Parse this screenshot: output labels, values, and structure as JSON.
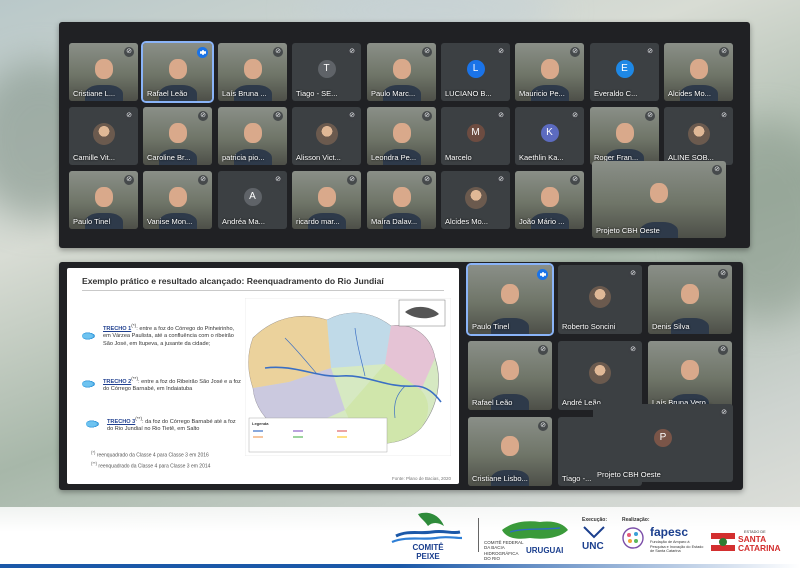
{
  "top_grid": [
    {
      "name": "Cristiane L...",
      "kind": "cam"
    },
    {
      "name": "Rafael Leão",
      "kind": "cam",
      "speaking": true
    },
    {
      "name": "Laís Bruna ...",
      "kind": "cam"
    },
    {
      "name": "Tiago - SE...",
      "kind": "avatar",
      "initial": "T",
      "color": "#5f6368"
    },
    {
      "name": "Paulo Marc...",
      "kind": "cam"
    },
    {
      "name": "LUCIANO B...",
      "kind": "avatar",
      "initial": "L",
      "color": "#1a73e8"
    },
    {
      "name": "Mauricio Pe...",
      "kind": "cam"
    },
    {
      "name": "Everaldo C...",
      "kind": "avatar",
      "initial": "E",
      "color": "#1e88e5"
    },
    {
      "name": "Alcides Mo...",
      "kind": "cam"
    },
    {
      "name": "Camille Vit...",
      "kind": "photo"
    },
    {
      "name": "Caroline Br...",
      "kind": "cam"
    },
    {
      "name": "patricia pio...",
      "kind": "cam"
    },
    {
      "name": "Alisson Vict...",
      "kind": "photo"
    },
    {
      "name": "Leondra Pe...",
      "kind": "cam"
    },
    {
      "name": "Marcelo",
      "kind": "avatar",
      "initial": "M",
      "color": "#6d4c41"
    },
    {
      "name": "Kaethlin Ka...",
      "kind": "avatar",
      "initial": "K",
      "color": "#5c6bc0"
    },
    {
      "name": "Roger Fran...",
      "kind": "cam"
    },
    {
      "name": "ALINE SOB...",
      "kind": "photo"
    },
    {
      "name": "Paulo Tinel",
      "kind": "cam"
    },
    {
      "name": "Vanise Mon...",
      "kind": "cam"
    },
    {
      "name": "Andréa Ma...",
      "kind": "avatar",
      "initial": "A",
      "color": "#5f6368"
    },
    {
      "name": "ricardo mar...",
      "kind": "cam"
    },
    {
      "name": "Maíra Dalav...",
      "kind": "cam"
    },
    {
      "name": "Alcides Mo...",
      "kind": "photo"
    },
    {
      "name": "João Mário ...",
      "kind": "cam"
    },
    {
      "name": "Projeto CBH Oeste",
      "kind": "cam"
    }
  ],
  "bottom_grid": [
    {
      "name": "Paulo Tinel",
      "kind": "cam",
      "speaking": true
    },
    {
      "name": "Roberto Soncini",
      "kind": "photo"
    },
    {
      "name": "Denis Silva",
      "kind": "cam"
    },
    {
      "name": "Rafael Leão",
      "kind": "cam"
    },
    {
      "name": "André Leão",
      "kind": "photo"
    },
    {
      "name": "Laís Bruna Vero...",
      "kind": "cam"
    },
    {
      "name": "Cristiane Lisbo...",
      "kind": "cam"
    },
    {
      "name": "Tiago -...",
      "kind": "blank"
    },
    {
      "name": "Projeto CBH Oeste",
      "kind": "avatar",
      "initial": "P",
      "color": "#7a5548"
    }
  ],
  "slide": {
    "title": "Exemplo prático e resultado alcançado: Reenquadramento do Rio Jundiaí",
    "trecho1_label": "TRECHO 1",
    "trecho1_mark": "(*)",
    "trecho1_text": ": entre a foz do Córrego do Pinheirinho, em Várzea Paulista, até a confluência com o ribeirão São José, em Itupeva, a jusante da cidade;",
    "trecho2_label": "TRECHO 2",
    "trecho2_mark": "(**)",
    "trecho2_text": ": entre a foz do Ribeirão São José e a foz do Córrego Barnabé, em Indaiatuba",
    "trecho3_label": "TRECHO 3",
    "trecho3_mark": "(**)",
    "trecho3_text": ": da foz do Córrego Barnabé até a foz do Rio Jundiaí no Rio Tietê, em Salto",
    "footnote1_mark": "(*)",
    "footnote1": "reenquadrado da Classe 4 para Classe 3 em 2016",
    "footnote2_mark": "(**)",
    "footnote2": "reenquadrado da Classe 4 para Classe 3 em 2014",
    "legend_title": "Legenda",
    "source": "Fonte: Plano de Bacias, 2020",
    "colors": {
      "trecho_label": "#1f3f8f"
    }
  },
  "footer": {
    "comite_line1": "COMITÊ",
    "comite_line2": "PEIXE",
    "uruguai_caption": "COMITÊ FEDERAL DA BACIA HIDROGRÁFICA DO RIO",
    "uruguai": "URUGUAI",
    "execucao_label": "Execução:",
    "unc": "UNC",
    "realizacao_label": "Realização:",
    "fapesc": "fapesc",
    "fapesc_caption": "Fundação de Amparo à Pesquisa e Inovação do Estado de Santa Catarina",
    "sc_caption": "ESTADO DE",
    "sc_line1": "SANTA",
    "sc_line2": "CATARINA"
  },
  "colors": {
    "panel_bg": "#202124",
    "tile_bg": "#3c4043",
    "speaking_blue": "#1a73e8",
    "brand_blue": "#1b3f8e",
    "sc_red": "#d32f2f"
  }
}
